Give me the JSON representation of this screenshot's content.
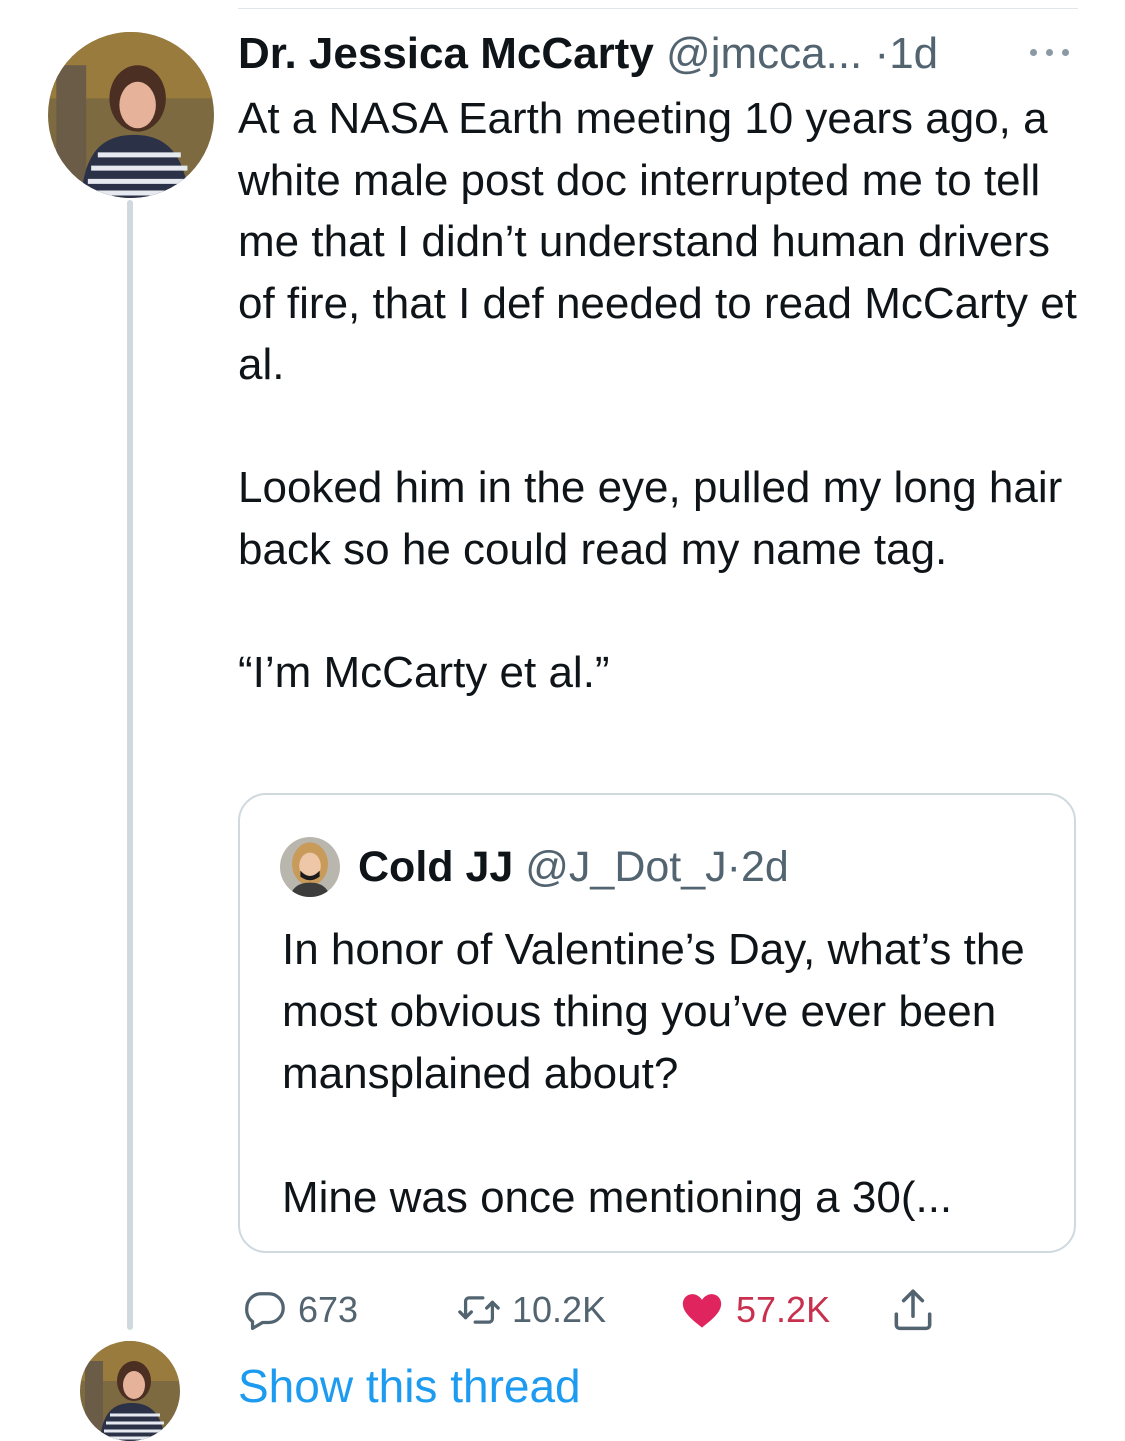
{
  "tweet": {
    "author_name": "Dr. Jessica McCarty",
    "author_handle": "@jmcca...",
    "separator": "·",
    "time": "1d",
    "paragraphs": [
      "At a NASA Earth meeting 10 years ago, a white male post doc interrupted me to tell me that I didn’t understand human drivers of fire, that I def needed to read McCarty et al.",
      "Looked him in the eye, pulled my long hair back so he could read my name tag.",
      "“I’m McCarty et al.”"
    ]
  },
  "quote": {
    "author_name": "Cold JJ",
    "author_handle": "@J_Dot_J",
    "separator": "·",
    "time": "2d",
    "paragraphs": [
      "In honor of Valentine’s Day, what’s the most obvious thing you’ve ever been mansplained about?",
      "Mine was once mentioning a 30(..."
    ]
  },
  "actions": {
    "replies": "673",
    "retweets": "10.2K",
    "likes": "57.2K"
  },
  "show_thread": "Show this thread",
  "colors": {
    "link": "#1d9bf0",
    "like": "#e0245e",
    "muted": "#536471",
    "thread_line": "#cfd9de"
  },
  "icons": [
    "more-icon",
    "reply-icon",
    "retweet-icon",
    "heart-icon",
    "share-icon"
  ]
}
